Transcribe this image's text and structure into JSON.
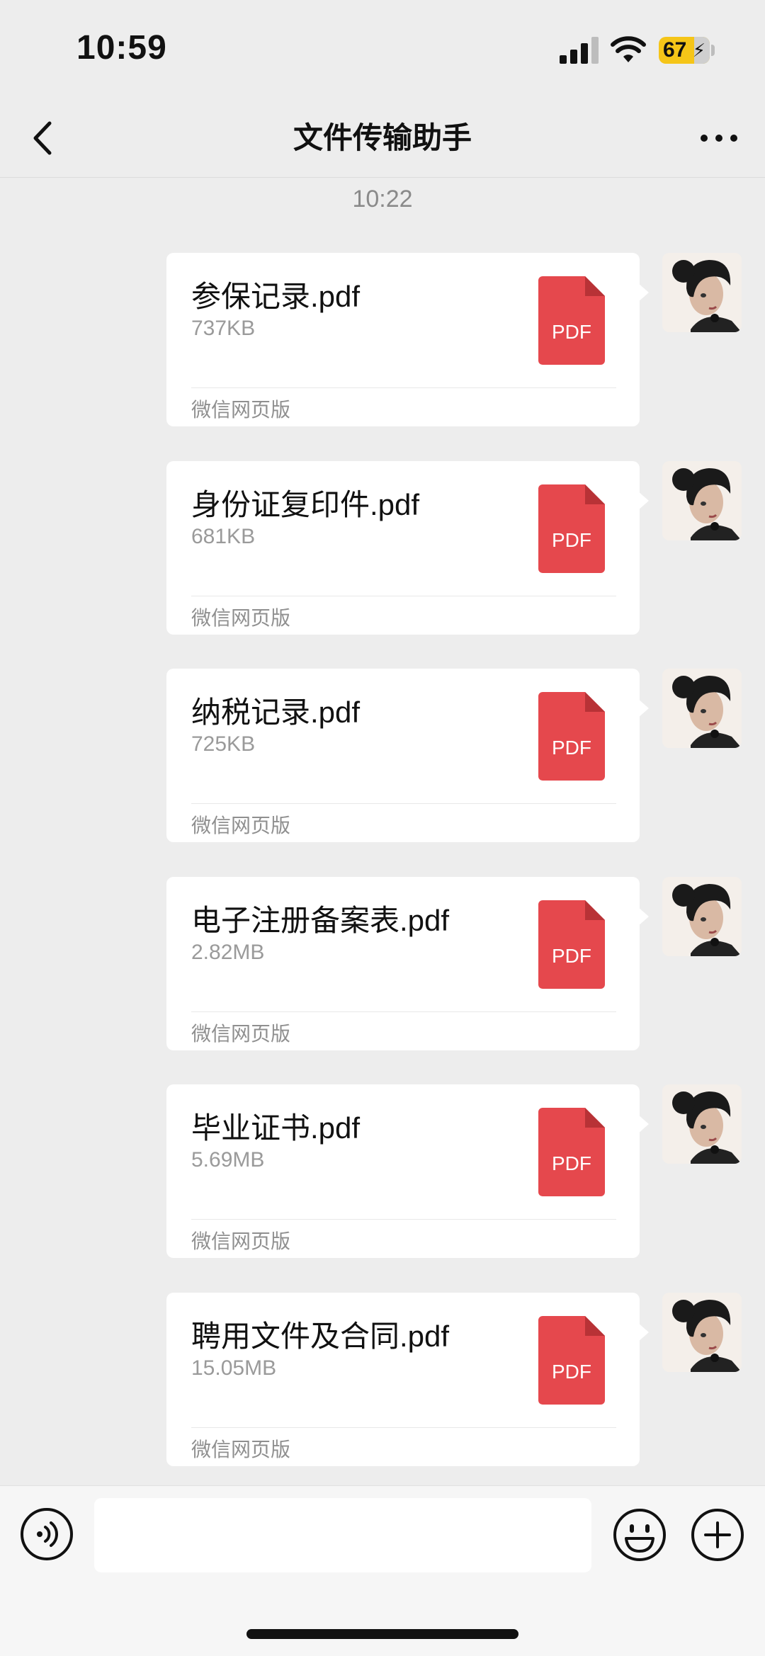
{
  "status_bar": {
    "time": "10:59",
    "battery_level": "67",
    "icons": [
      "signal-icon",
      "wifi-icon",
      "battery-icon"
    ]
  },
  "header": {
    "title": "文件传输助手",
    "back_icon": "chevron-left-icon",
    "more_icon": "more-dots-icon"
  },
  "timestamp": "10:22",
  "messages": [
    {
      "file_name": "参保记录.pdf",
      "size": "737KB",
      "icon_label": "PDF",
      "source": "微信网页版"
    },
    {
      "file_name": "身份证复印件.pdf",
      "size": "681KB",
      "icon_label": "PDF",
      "source": "微信网页版"
    },
    {
      "file_name": "纳税记录.pdf",
      "size": "725KB",
      "icon_label": "PDF",
      "source": "微信网页版"
    },
    {
      "file_name": "电子注册备案表.pdf",
      "size": "2.82MB",
      "icon_label": "PDF",
      "source": "微信网页版"
    },
    {
      "file_name": "毕业证书.pdf",
      "size": "5.69MB",
      "icon_label": "PDF",
      "source": "微信网页版"
    },
    {
      "file_name": "聘用文件及合同.pdf",
      "size": "15.05MB",
      "icon_label": "PDF",
      "source": "微信网页版"
    }
  ],
  "input_bar": {
    "text_value": "",
    "icons": [
      "voice-icon",
      "emoji-icon",
      "plus-icon"
    ]
  },
  "colors": {
    "background": "#ededed",
    "bubble": "#ffffff",
    "pdf_red": "#e5484d",
    "battery_yellow": "#f5c518"
  }
}
